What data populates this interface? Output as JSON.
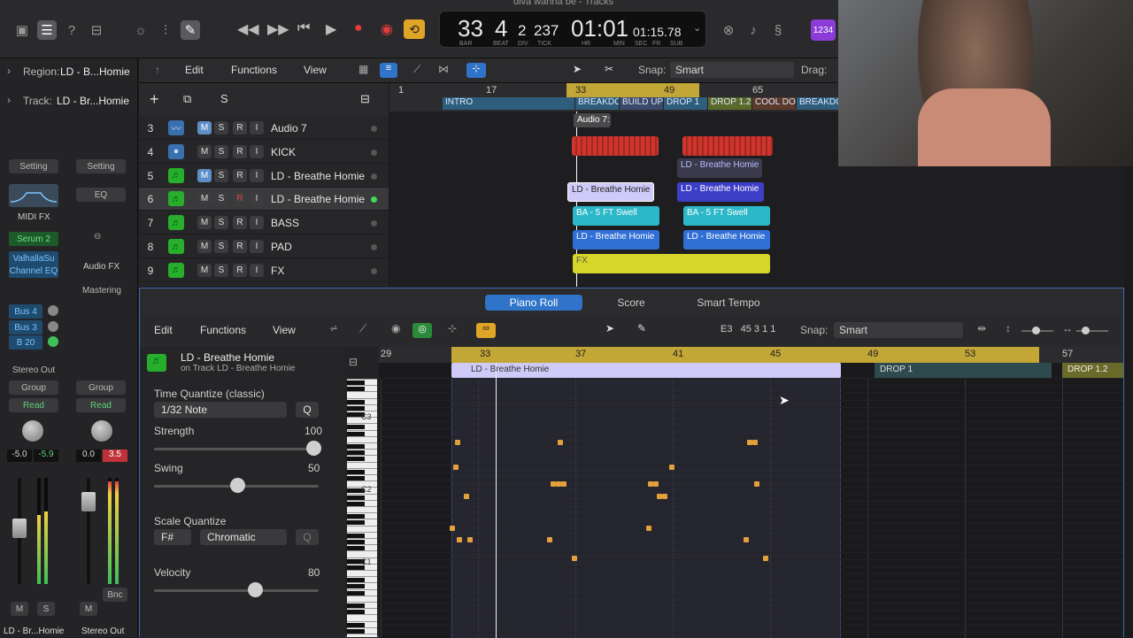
{
  "window_title": "diva wanna be - Tracks",
  "toolbar": {
    "lcd": {
      "bar": "33",
      "beat": "4",
      "div": "2",
      "tick": "237",
      "time": "01:01",
      "time_small": "01:15.78",
      "bar_lbl": "BAR",
      "beat_lbl": "BEAT",
      "div_lbl": "DIV",
      "tick_lbl": "TICK",
      "hr_lbl": "HR",
      "min_lbl": "MIN",
      "sec_lbl": "SEC",
      "fr_lbl": "FR",
      "sub_lbl": "SUB"
    },
    "count_badge": "1234"
  },
  "inspector": {
    "region_label": "Region:",
    "region_value": "LD - B...Homie",
    "track_label": "Track:",
    "track_value": "LD - Br...Homie",
    "setting1": "Setting",
    "setting2": "Setting",
    "eq": "EQ",
    "midi_fx": "MIDI FX",
    "audio_fx": "Audio FX",
    "serum": "Serum 2",
    "valhalla": "ValhallaSu",
    "channel_eq": "Channel EQ",
    "mastering": "Mastering",
    "bus4": "Bus 4",
    "bus3": "Bus 3",
    "b20": "B 20",
    "stereo_out": "Stereo Out",
    "group1": "Group",
    "group2": "Group",
    "read1": "Read",
    "read2": "Read",
    "vol1a": "-5.0",
    "vol1b": "-5.9",
    "vol2a": "0.0",
    "vol2b": "3.5",
    "m1": "M",
    "s1": "S",
    "m2": "M",
    "bnc": "Bnc",
    "ch1_name": "LD - Br...Homie",
    "ch2_name": "Stereo Out"
  },
  "tracks_toolbar": {
    "edit": "Edit",
    "functions": "Functions",
    "view": "View",
    "snap_label": "Snap:",
    "snap_value": "Smart",
    "drag_label": "Drag:"
  },
  "tracks": [
    {
      "num": "3",
      "name": "Audio 7",
      "icon": "waveform-icon"
    },
    {
      "num": "4",
      "name": "KICK",
      "icon": "drum-icon"
    },
    {
      "num": "5",
      "name": "LD - Breathe Homie",
      "icon": "midi-icon"
    },
    {
      "num": "6",
      "name": "LD - Breathe Homie",
      "icon": "midi-icon"
    },
    {
      "num": "7",
      "name": "BASS",
      "icon": "midi-icon"
    },
    {
      "num": "8",
      "name": "PAD",
      "icon": "midi-icon"
    },
    {
      "num": "9",
      "name": "FX",
      "icon": "midi-icon"
    }
  ],
  "track_buttons": {
    "m": "M",
    "s": "S",
    "r": "R",
    "i": "I"
  },
  "ruler": [
    "1",
    "17",
    "33",
    "49",
    "65"
  ],
  "markers": [
    "INTRO",
    "BREAKDO",
    "BUILD UP",
    "DROP 1",
    "DROP 1.2",
    "COOL DO",
    "BREAKDO"
  ],
  "regions": {
    "audio7": "Audio 7:",
    "ld5": "LD - Breathe Homie",
    "ld6a": "LD - Breathe Homie",
    "ld6b": "LD - Breathe Homie",
    "bass_a": "BA - 5 FT Swell",
    "bass_b": "BA - 5 FT Swell",
    "pad_a": "LD - Breathe Homie",
    "pad_b": "LD - Breathe Homie",
    "fx": "FX"
  },
  "piano_roll": {
    "tabs": [
      "Piano Roll",
      "Score",
      "Smart Tempo"
    ],
    "edit": "Edit",
    "functions": "Functions",
    "view": "View",
    "position": "E3   45 3 1 1",
    "snap_label": "Snap:",
    "snap_value": "Smart",
    "region_name": "LD - Breathe Homie",
    "region_sub": "on Track LD - Breathe Homie",
    "tq_label": "Time Quantize (classic)",
    "tq_value": "1/32 Note",
    "q_btn": "Q",
    "strength_label": "Strength",
    "strength_value": "100",
    "swing_label": "Swing",
    "swing_value": "50",
    "scale_label": "Scale Quantize",
    "scale_key": "F#",
    "scale_type": "Chromatic",
    "velocity_label": "Velocity",
    "velocity_value": "80",
    "ruler": [
      "29",
      "33",
      "37",
      "41",
      "45",
      "49",
      "53",
      "57"
    ],
    "region_bar": "LD - Breathe Homie",
    "marker_drop1": "DROP 1",
    "marker_drop12": "DROP 1.2",
    "key_c3": "C3",
    "key_c2": "C2",
    "key_c1": "C1"
  }
}
